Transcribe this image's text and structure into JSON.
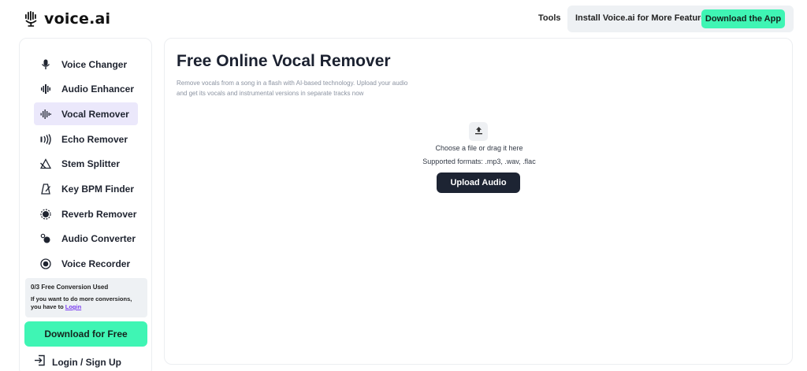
{
  "brand": {
    "name": "voice.ai"
  },
  "header": {
    "tools_label": "Tools",
    "install_text": "Install Voice.ai for More Features",
    "download_app_label": "Download the App",
    "accent_color": "#3ff5b4"
  },
  "sidebar": {
    "items": [
      {
        "label": "Voice Changer",
        "icon": "microphone-icon",
        "active": false
      },
      {
        "label": "Audio Enhancer",
        "icon": "audio-enhancer-icon",
        "active": false
      },
      {
        "label": "Vocal Remover",
        "icon": "waveform-icon",
        "active": true
      },
      {
        "label": "Echo Remover",
        "icon": "echo-waves-icon",
        "active": false
      },
      {
        "label": "Stem Splitter",
        "icon": "triangle-split-icon",
        "active": false
      },
      {
        "label": "Key BPM Finder",
        "icon": "metronome-icon",
        "active": false
      },
      {
        "label": "Reverb Remover",
        "icon": "reverb-icon",
        "active": false
      },
      {
        "label": "Audio Converter",
        "icon": "converter-icon",
        "active": false
      },
      {
        "label": "Voice Recorder",
        "icon": "record-icon",
        "active": false
      }
    ],
    "usage": {
      "title": "0/3 Free Conversion Used",
      "description": "If you want to do more conversions, you have to ",
      "login_link": "Login"
    },
    "download_free_label": "Download for Free",
    "login_signup_label": "Login / Sign Up"
  },
  "main": {
    "title": "Free Online Vocal Remover",
    "subtitle": "Remove vocals from a song in a flash with AI-based technology. Upload your audio and get its vocals and instrumental versions in separate tracks now",
    "choose_text": "Choose a file or drag it here",
    "formats_text": "Supported formats: .mp3, .wav, .flac",
    "upload_button_label": "Upload Audio"
  }
}
